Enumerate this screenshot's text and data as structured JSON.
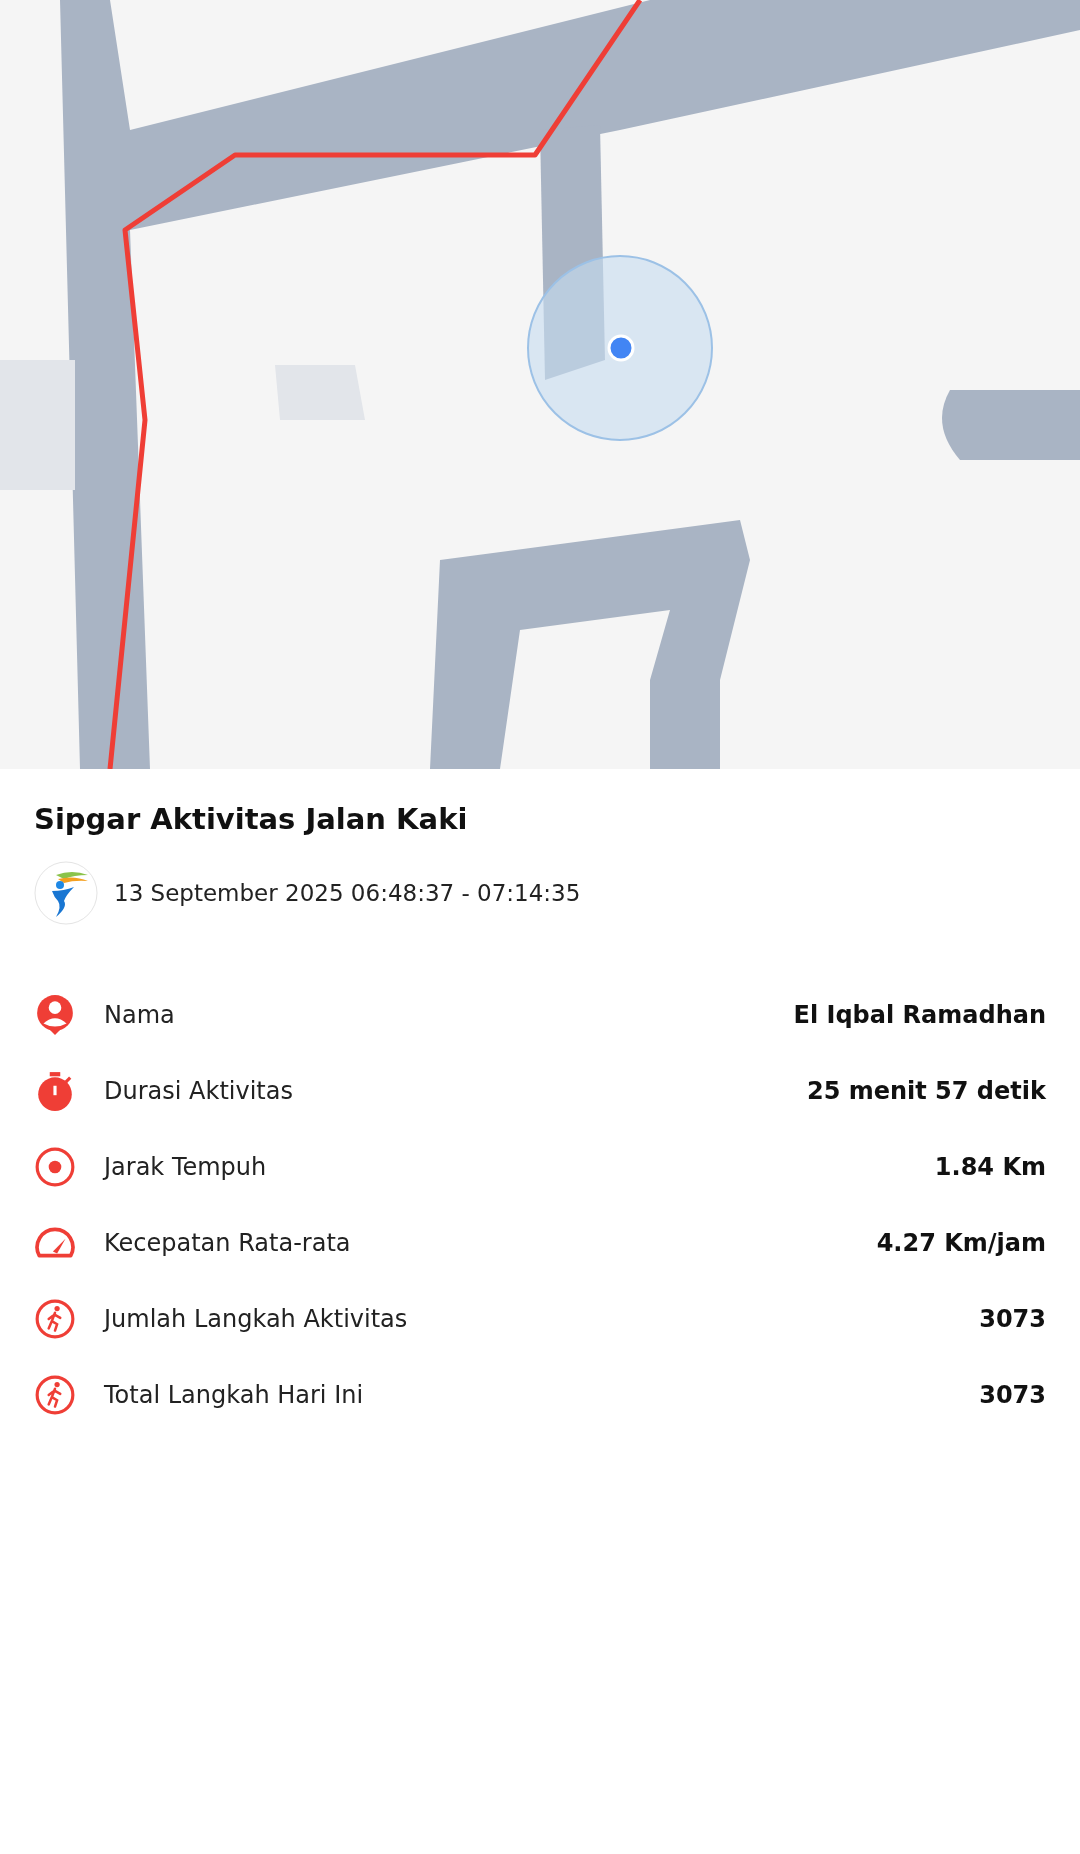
{
  "activity": {
    "title": "Sipgar Aktivitas Jalan Kaki",
    "datetime": "13 September 2025 06:48:37 - 07:14:35"
  },
  "stats": [
    {
      "kind": "person",
      "label": "Nama",
      "value": "El Iqbal Ramadhan"
    },
    {
      "kind": "timer",
      "label": "Durasi Aktivitas",
      "value": "25 menit 57 detik"
    },
    {
      "kind": "target",
      "label": "Jarak Tempuh",
      "value": "1.84 Km"
    },
    {
      "kind": "speed",
      "label": "Kecepatan Rata-rata",
      "value": "4.27 Km/jam"
    },
    {
      "kind": "walk",
      "label": "Jumlah Langkah Aktivitas",
      "value": "3073"
    },
    {
      "kind": "walk",
      "label": "Total Langkah Hari Ini",
      "value": "3073"
    }
  ]
}
